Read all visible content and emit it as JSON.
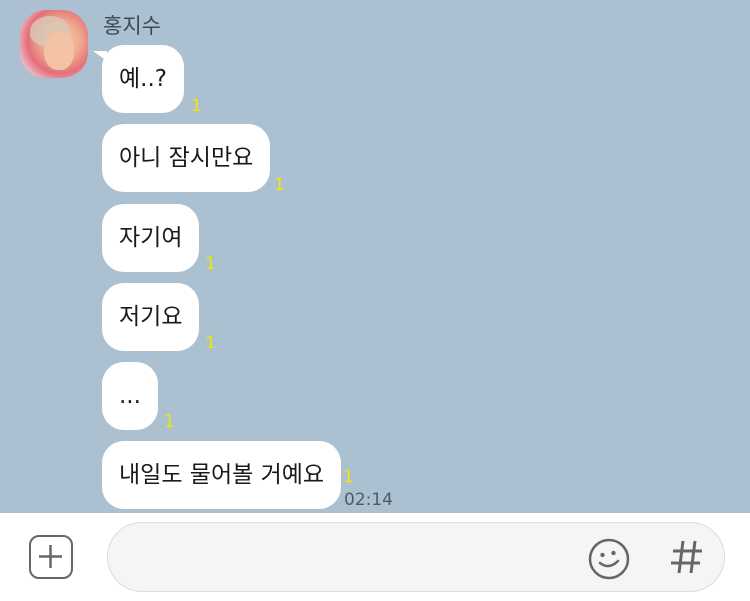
{
  "chat": {
    "sender_name": "홍지수",
    "messages": [
      {
        "text": "예..?",
        "unread": "1"
      },
      {
        "text": "아니 잠시만요",
        "unread": "1"
      },
      {
        "text": "자기여",
        "unread": "1"
      },
      {
        "text": "저기요",
        "unread": "1"
      },
      {
        "text": "...",
        "unread": "1"
      },
      {
        "text": "내일도 물어볼 거예요",
        "unread": "1"
      }
    ],
    "last_time": "02:14"
  },
  "input_bar": {
    "message_value": "",
    "icons": {
      "attach": "plus-square-icon",
      "emoticon": "smiley-icon",
      "search": "hashtag-icon"
    }
  },
  "colors": {
    "chat_background": "#abc1d1",
    "bubble": "#ffffff",
    "unread_count": "#f2e600",
    "input_bar_background": "#ffffff"
  }
}
